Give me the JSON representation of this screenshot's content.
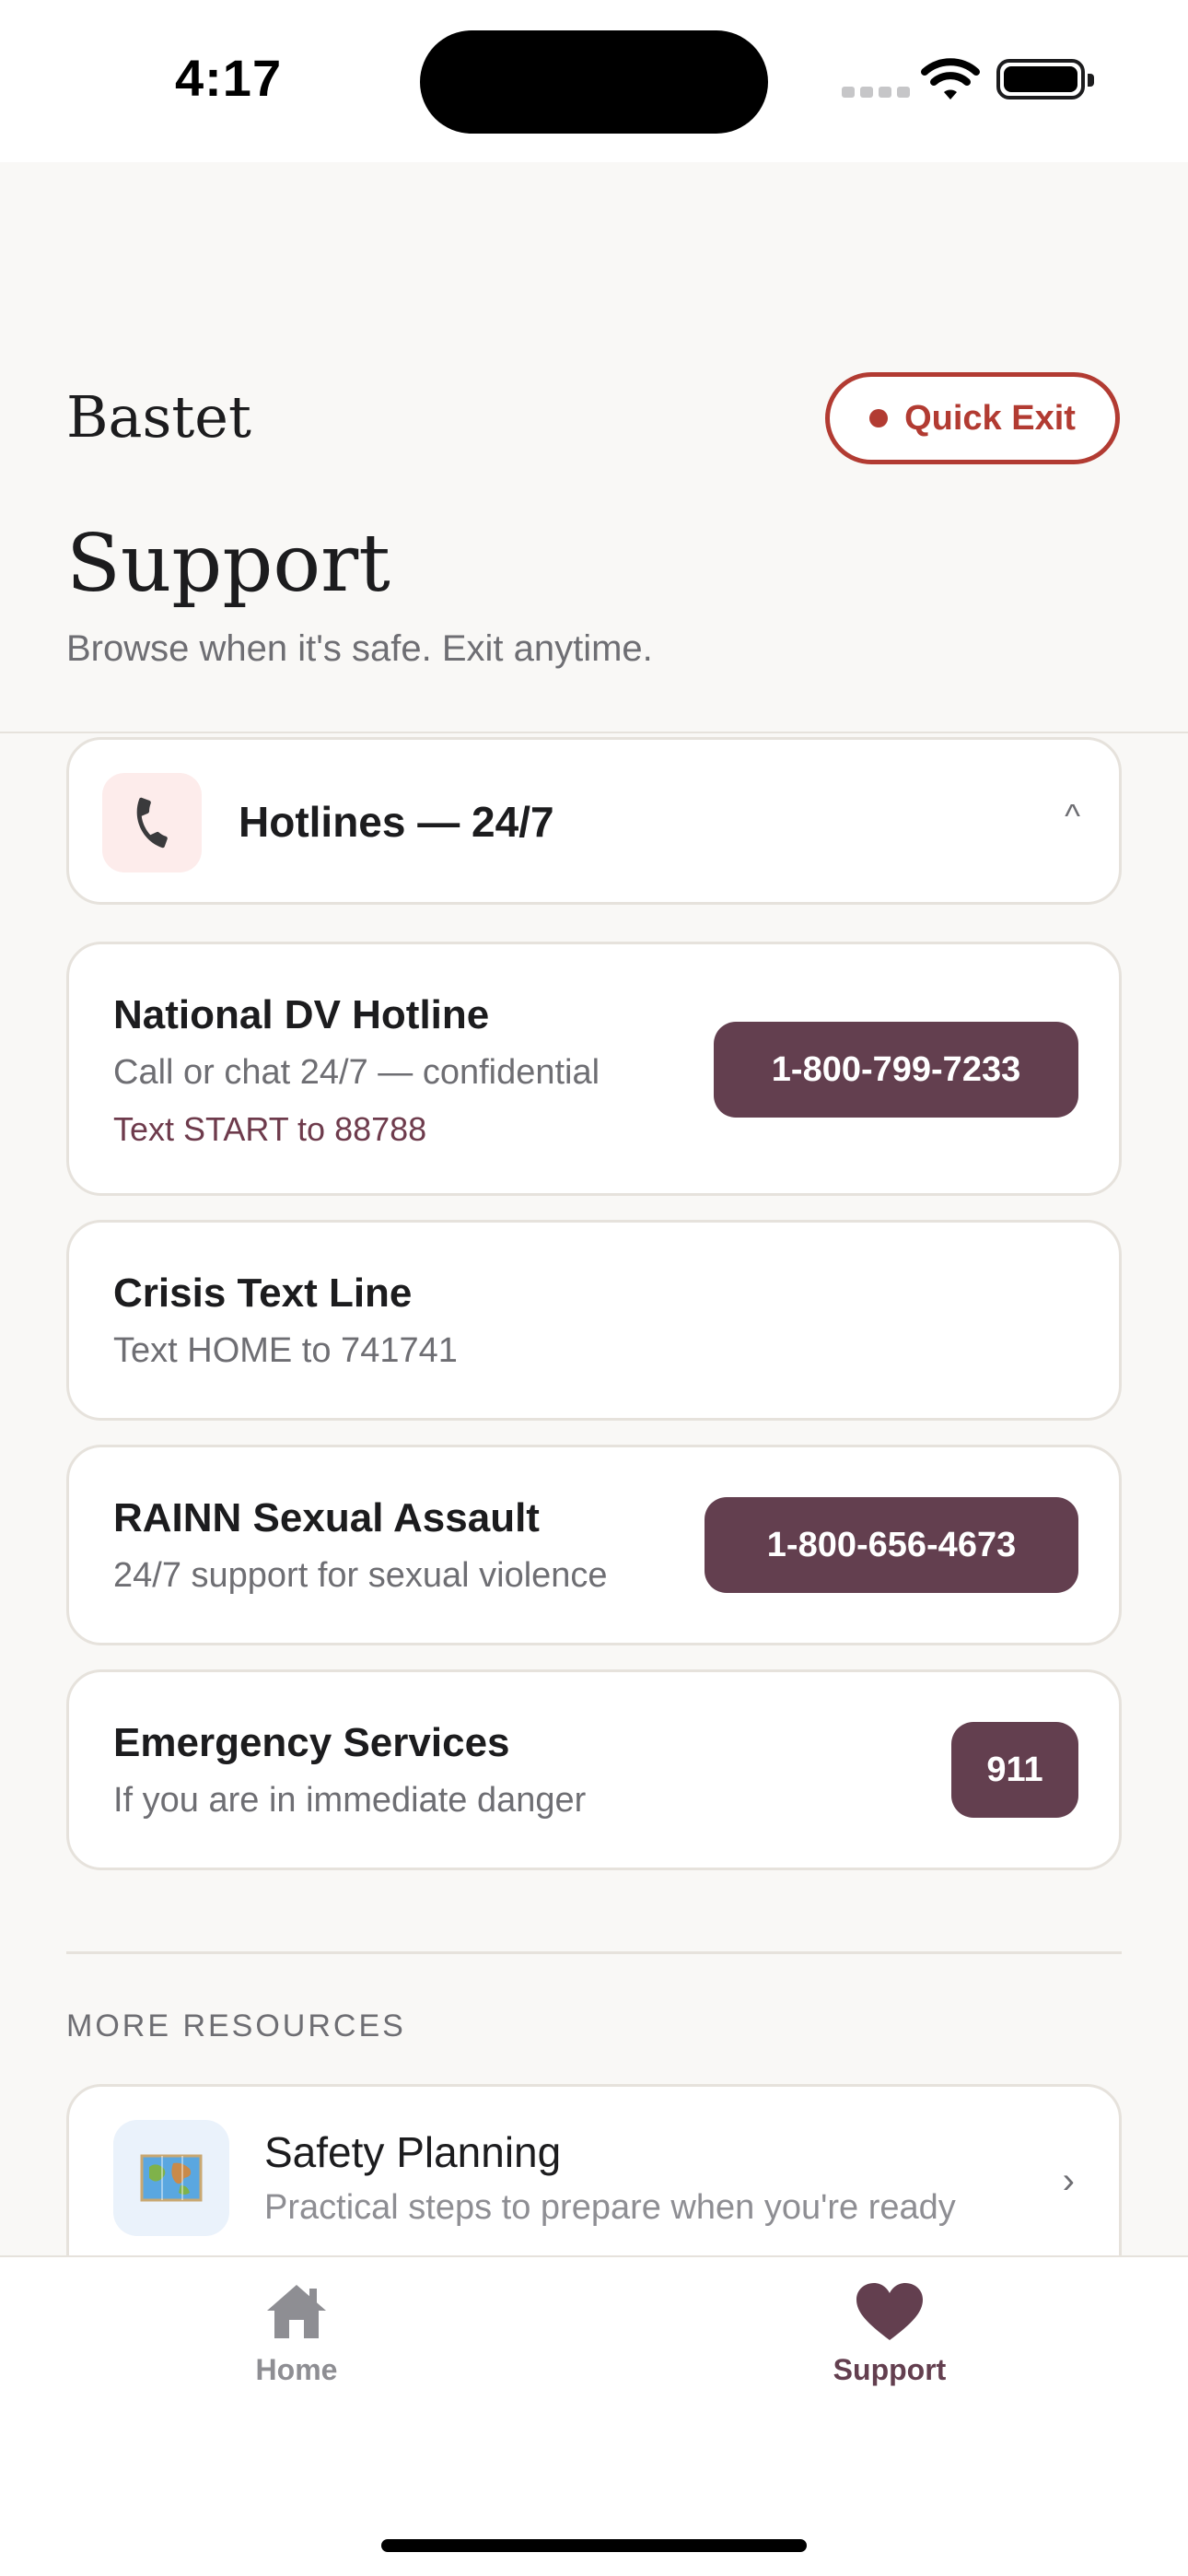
{
  "status_bar": {
    "time": "4:17"
  },
  "header": {
    "brand": "Bastet",
    "quick_exit_label": "Quick Exit",
    "title": "Support",
    "subtitle": "Browse when it's safe. Exit anytime."
  },
  "hotlines_section": {
    "title": "Hotlines — 24/7",
    "icon": "phone-icon",
    "caret": "^",
    "items": [
      {
        "name": "National DV Hotline",
        "description": "Call or chat 24/7 — confidential",
        "extra": "Text START to 88788",
        "button": "1-800-799-7233"
      },
      {
        "name": "Crisis Text Line",
        "description": "Text HOME to 741741"
      },
      {
        "name": "RAINN Sexual Assault",
        "description": "24/7 support for sexual violence",
        "button": "1-800-656-4673"
      },
      {
        "name": "Emergency Services",
        "description": "If you are in immediate danger",
        "button": "911"
      }
    ]
  },
  "more_resources": {
    "label": "MORE RESOURCES",
    "items": [
      {
        "title": "Safety Planning",
        "description": "Practical steps to prepare when you're ready",
        "icon": "map-icon",
        "chevron": "›"
      }
    ]
  },
  "tab_bar": {
    "tabs": [
      {
        "label": "Home",
        "icon": "house-icon",
        "active": false
      },
      {
        "label": "Support",
        "icon": "heart-icon",
        "active": true
      }
    ]
  },
  "colors": {
    "accent": "#633f4f",
    "quick_exit": "#b23b32",
    "background": "#f9f8f6",
    "card_border": "#e6e2dc"
  }
}
